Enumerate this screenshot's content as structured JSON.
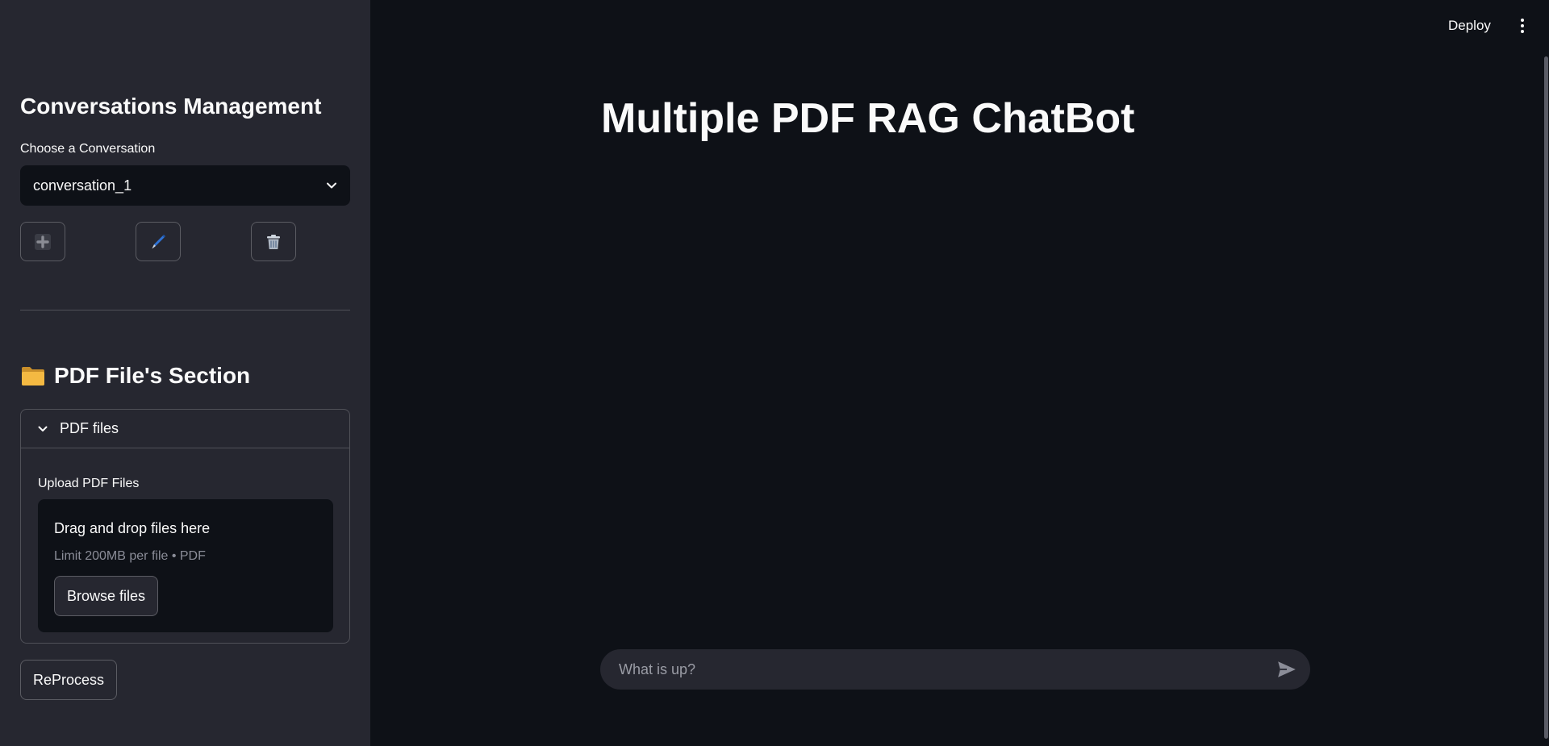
{
  "sidebar": {
    "conversations_heading": "Conversations Management",
    "choose_label": "Choose a Conversation",
    "selected_conversation": "conversation_1",
    "pdf_section_heading": "PDF File's Section",
    "expander_title": "PDF files",
    "upload_label": "Upload PDF Files",
    "dropzone_title": "Drag and drop files here",
    "dropzone_limit": "Limit 200MB per file • PDF",
    "browse_button": "Browse files",
    "reprocess_button": "ReProcess",
    "icons": {
      "add": "plus-icon",
      "edit": "pen-icon",
      "delete": "trash-icon",
      "folder": "folder-icon"
    }
  },
  "header": {
    "deploy_label": "Deploy",
    "menu_icon": "more-vertical-icon"
  },
  "main": {
    "title": "Multiple PDF RAG ChatBot",
    "chat_placeholder": "What is up?"
  },
  "colors": {
    "main_bg": "#0e1117",
    "sidebar_bg": "#262730",
    "text": "#fafafa",
    "muted": "#8b8d98"
  }
}
